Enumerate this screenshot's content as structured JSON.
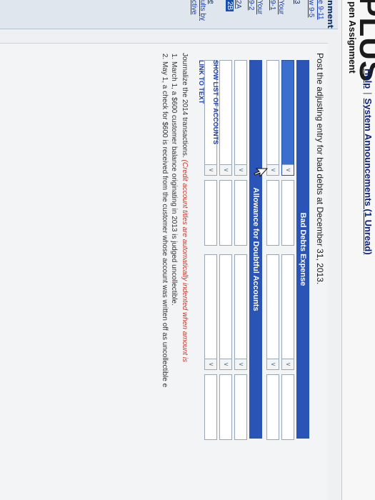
{
  "header": {
    "brand": "PLUS",
    "help_link": "Help",
    "separator": "|",
    "announcements_link": "System Announcements (1 Unread)",
    "subtitle": "pen Assignment"
  },
  "sidebar": {
    "title": "nment",
    "items": [
      {
        "label": "e 9-11"
      },
      {
        "label": "w 9-5"
      },
      {
        "label": "3"
      },
      {
        "label": "Your"
      },
      {
        "label": "9-1"
      },
      {
        "label": "Your"
      },
      {
        "label": "9-2"
      },
      {
        "label": "2A"
      },
      {
        "label": "2B"
      },
      {
        "label": "e"
      },
      {
        "label": "ults by"
      },
      {
        "label": "ctive"
      }
    ]
  },
  "main": {
    "prompt": "Post the adjusting entry for bad debts at December 31, 2013.",
    "accounts": [
      {
        "title": "Bad Debts Expense"
      },
      {
        "title": "Allowance for Doubtful Accounts"
      }
    ],
    "show_accounts_link": "SHOW LIST OF ACCOUNTS",
    "link_to_text": "LINK TO TEXT",
    "instruction": "Journalize the 2014 transactions.",
    "instruction_note": "(Credit account titles are automatically indented when amount is",
    "transactions": [
      "March 1, a $600 customer balance originating in 2013 is judged uncollectible.",
      "May 1, a check for $600 is received from the customer whose account was written off as uncollectible e"
    ]
  }
}
